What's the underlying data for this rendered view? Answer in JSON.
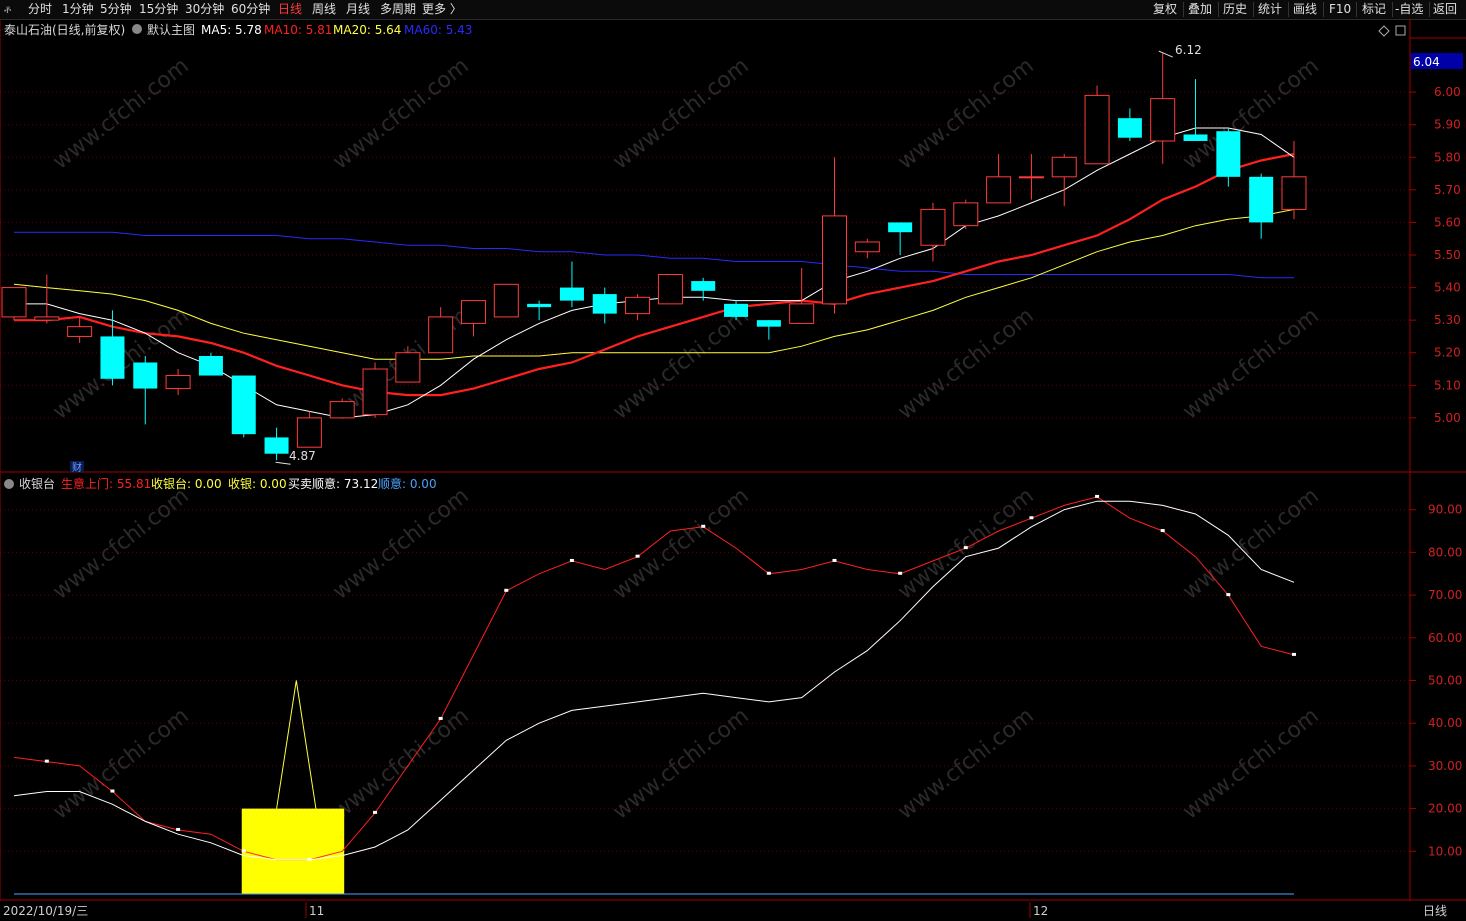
{
  "toolbar": {
    "logo": "ቶ",
    "periods": [
      "分时",
      "1分钟",
      "5分钟",
      "15分钟",
      "30分钟",
      "60分钟",
      "日线",
      "周线",
      "月线",
      "多周期",
      "更多 〉"
    ],
    "active_period": "日线",
    "right": [
      "复权",
      "叠加",
      "历史",
      "统计",
      "画线",
      "F10",
      "标记",
      "-自选",
      "返回"
    ]
  },
  "main_legend": {
    "stock": "泰山石油(日线,前复权)",
    "template": "默认主图",
    "ma": [
      {
        "label": "MA5: 5.78",
        "color": "#ffffff"
      },
      {
        "label": "MA10: 5.81",
        "color": "#ff2020"
      },
      {
        "label": "MA20: 5.64",
        "color": "#ffff40"
      },
      {
        "label": "MA60: 5.43",
        "color": "#2a2aff"
      }
    ]
  },
  "price_badge": "6.04",
  "high_label": "6.12",
  "low_label": "4.87",
  "fin_marker": "财",
  "sub_legend": {
    "name": "收银台",
    "items": [
      {
        "label": "生意上门: 55.81",
        "color": "#ff2020"
      },
      {
        "label": "收银台: 0.00",
        "color": "#ffff40"
      },
      {
        "label": "收银: 0.00",
        "color": "#ffff40"
      },
      {
        "label": "买卖顺意: 73.12",
        "color": "#ffffff"
      },
      {
        "label": "顺意: 0.00",
        "color": "#4aa3ff"
      }
    ]
  },
  "bottom": {
    "date": "2022/10/19/三",
    "ticks": [
      "11",
      "12"
    ],
    "period": "日线"
  },
  "watermark": "www.cfchi.com",
  "colors": {
    "up": "#ff3c3c",
    "down": "#00ffff",
    "ma5": "#ffffff",
    "ma10": "#ff2020",
    "ma20": "#ffff40",
    "ma60": "#2a2aff",
    "axis": "#a00000",
    "grid": "#5a0000",
    "label": "#d02020"
  },
  "chart_data": [
    {
      "type": "candlestick",
      "title": "泰山石油(日线,前复权)",
      "y_ticks": [
        "6.00",
        "5.90",
        "5.80",
        "5.70",
        "5.60",
        "5.50",
        "5.40",
        "5.30",
        "5.20",
        "5.10",
        "5.00"
      ],
      "ylim": [
        4.84,
        6.16
      ],
      "candles": [
        {
          "o": 5.31,
          "h": 5.4,
          "l": 5.3,
          "c": 5.4
        },
        {
          "o": 5.3,
          "h": 5.44,
          "l": 5.29,
          "c": 5.31
        },
        {
          "o": 5.25,
          "h": 5.31,
          "l": 5.23,
          "c": 5.28
        },
        {
          "o": 5.25,
          "h": 5.33,
          "l": 5.1,
          "c": 5.12
        },
        {
          "o": 5.17,
          "h": 5.19,
          "l": 4.98,
          "c": 5.09
        },
        {
          "o": 5.09,
          "h": 5.15,
          "l": 5.07,
          "c": 5.13
        },
        {
          "o": 5.19,
          "h": 5.2,
          "l": 5.13,
          "c": 5.13
        },
        {
          "o": 5.13,
          "h": 5.13,
          "l": 4.94,
          "c": 4.95
        },
        {
          "o": 4.94,
          "h": 4.97,
          "l": 4.87,
          "c": 4.89
        },
        {
          "o": 4.91,
          "h": 5.02,
          "l": 4.91,
          "c": 5.0
        },
        {
          "o": 5.0,
          "h": 5.06,
          "l": 5.0,
          "c": 5.05
        },
        {
          "o": 5.01,
          "h": 5.17,
          "l": 5.0,
          "c": 5.15
        },
        {
          "o": 5.11,
          "h": 5.22,
          "l": 5.11,
          "c": 5.2
        },
        {
          "o": 5.2,
          "h": 5.34,
          "l": 5.2,
          "c": 5.31
        },
        {
          "o": 5.29,
          "h": 5.36,
          "l": 5.25,
          "c": 5.36
        },
        {
          "o": 5.31,
          "h": 5.41,
          "l": 5.31,
          "c": 5.41
        },
        {
          "o": 5.35,
          "h": 5.36,
          "l": 5.3,
          "c": 5.34
        },
        {
          "o": 5.4,
          "h": 5.48,
          "l": 5.34,
          "c": 5.36
        },
        {
          "o": 5.38,
          "h": 5.4,
          "l": 5.29,
          "c": 5.32
        },
        {
          "o": 5.32,
          "h": 5.38,
          "l": 5.3,
          "c": 5.37
        },
        {
          "o": 5.35,
          "h": 5.44,
          "l": 5.35,
          "c": 5.44
        },
        {
          "o": 5.42,
          "h": 5.43,
          "l": 5.36,
          "c": 5.39
        },
        {
          "o": 5.35,
          "h": 5.36,
          "l": 5.3,
          "c": 5.31
        },
        {
          "o": 5.3,
          "h": 5.3,
          "l": 5.24,
          "c": 5.28
        },
        {
          "o": 5.29,
          "h": 5.46,
          "l": 5.29,
          "c": 5.35
        },
        {
          "o": 5.35,
          "h": 5.8,
          "l": 5.32,
          "c": 5.62
        },
        {
          "o": 5.51,
          "h": 5.55,
          "l": 5.49,
          "c": 5.54
        },
        {
          "o": 5.6,
          "h": 5.6,
          "l": 5.5,
          "c": 5.57
        },
        {
          "o": 5.53,
          "h": 5.66,
          "l": 5.48,
          "c": 5.64
        },
        {
          "o": 5.59,
          "h": 5.67,
          "l": 5.58,
          "c": 5.66
        },
        {
          "o": 5.66,
          "h": 5.81,
          "l": 5.66,
          "c": 5.74
        },
        {
          "o": 5.74,
          "h": 5.81,
          "l": 5.67,
          "c": 5.74
        },
        {
          "o": 5.74,
          "h": 5.81,
          "l": 5.65,
          "c": 5.8
        },
        {
          "o": 5.78,
          "h": 6.02,
          "l": 5.78,
          "c": 5.99
        },
        {
          "o": 5.92,
          "h": 5.95,
          "l": 5.85,
          "c": 5.86
        },
        {
          "o": 5.85,
          "h": 6.12,
          "l": 5.78,
          "c": 5.98
        },
        {
          "o": 5.87,
          "h": 6.04,
          "l": 5.85,
          "c": 5.85
        },
        {
          "o": 5.88,
          "h": 5.89,
          "l": 5.71,
          "c": 5.74
        },
        {
          "o": 5.74,
          "h": 5.75,
          "l": 5.55,
          "c": 5.6
        },
        {
          "o": 5.64,
          "h": 5.85,
          "l": 5.61,
          "c": 5.74
        }
      ],
      "ma": {
        "MA5": [
          5.35,
          5.35,
          5.32,
          5.3,
          5.26,
          5.2,
          5.16,
          5.1,
          5.04,
          5.02,
          5.0,
          5.01,
          5.04,
          5.1,
          5.18,
          5.24,
          5.29,
          5.33,
          5.35,
          5.36,
          5.37,
          5.37,
          5.36,
          5.36,
          5.36,
          5.42,
          5.45,
          5.49,
          5.52,
          5.59,
          5.62,
          5.66,
          5.7,
          5.76,
          5.81,
          5.86,
          5.89,
          5.89,
          5.87,
          5.8
        ],
        "MA10": [
          5.3,
          5.3,
          5.31,
          5.28,
          5.26,
          5.25,
          5.23,
          5.2,
          5.16,
          5.13,
          5.1,
          5.08,
          5.07,
          5.07,
          5.09,
          5.12,
          5.15,
          5.17,
          5.21,
          5.25,
          5.28,
          5.31,
          5.34,
          5.35,
          5.36,
          5.35,
          5.38,
          5.4,
          5.42,
          5.45,
          5.48,
          5.5,
          5.53,
          5.56,
          5.61,
          5.67,
          5.71,
          5.76,
          5.79,
          5.81
        ],
        "MA20": [
          5.41,
          5.4,
          5.39,
          5.38,
          5.36,
          5.33,
          5.29,
          5.26,
          5.24,
          5.22,
          5.2,
          5.18,
          5.18,
          5.18,
          5.19,
          5.19,
          5.19,
          5.2,
          5.2,
          5.2,
          5.2,
          5.2,
          5.2,
          5.2,
          5.22,
          5.25,
          5.27,
          5.3,
          5.33,
          5.37,
          5.4,
          5.43,
          5.47,
          5.51,
          5.54,
          5.56,
          5.59,
          5.61,
          5.62,
          5.64
        ],
        "MA60": [
          5.57,
          5.57,
          5.57,
          5.57,
          5.56,
          5.56,
          5.56,
          5.56,
          5.56,
          5.55,
          5.55,
          5.54,
          5.53,
          5.53,
          5.52,
          5.52,
          5.51,
          5.51,
          5.5,
          5.5,
          5.49,
          5.49,
          5.48,
          5.48,
          5.48,
          5.47,
          5.46,
          5.45,
          5.45,
          5.44,
          5.44,
          5.44,
          5.44,
          5.44,
          5.44,
          5.44,
          5.44,
          5.44,
          5.43,
          5.43
        ]
      }
    },
    {
      "type": "line",
      "title": "收银台",
      "y_ticks": [
        "90.00",
        "80.00",
        "70.00",
        "60.00",
        "50.00",
        "40.00",
        "30.00",
        "20.00",
        "10.00"
      ],
      "ylim": [
        0,
        100
      ],
      "series": [
        {
          "name": "生意上门",
          "color": "#ff2020",
          "values": [
            32,
            31,
            30,
            24,
            17,
            15,
            14,
            10,
            8,
            8,
            10,
            19,
            30,
            41,
            56,
            71,
            75,
            78,
            76,
            79,
            85,
            86,
            81,
            75,
            76,
            78,
            76,
            75,
            78,
            81,
            85,
            88,
            91,
            93,
            88,
            85,
            79,
            70,
            58,
            56
          ]
        },
        {
          "name": "买卖顺意",
          "color": "#ffffff",
          "values": [
            23,
            24,
            24,
            21,
            17,
            14,
            12,
            9,
            8,
            8,
            9,
            11,
            15,
            22,
            29,
            36,
            40,
            43,
            44,
            45,
            46,
            47,
            46,
            45,
            46,
            52,
            57,
            64,
            72,
            79,
            81,
            86,
            90,
            92,
            92,
            91,
            89,
            84,
            76,
            73
          ]
        },
        {
          "name": "收银台",
          "color": "#ffff40",
          "values": [
            0,
            0,
            0,
            0,
            0,
            0,
            0,
            0,
            0,
            50,
            0,
            0,
            0,
            0,
            0,
            0,
            0,
            0,
            0,
            0,
            0,
            0,
            0,
            0,
            0,
            0,
            0,
            0,
            0,
            0,
            0,
            0,
            0,
            0,
            0,
            0,
            0,
            0,
            0,
            0
          ]
        }
      ],
      "highlight": {
        "color": "#ffff00",
        "start_index": 7,
        "end_index": 10,
        "top": 20
      },
      "markers_on": "生意上门"
    }
  ]
}
